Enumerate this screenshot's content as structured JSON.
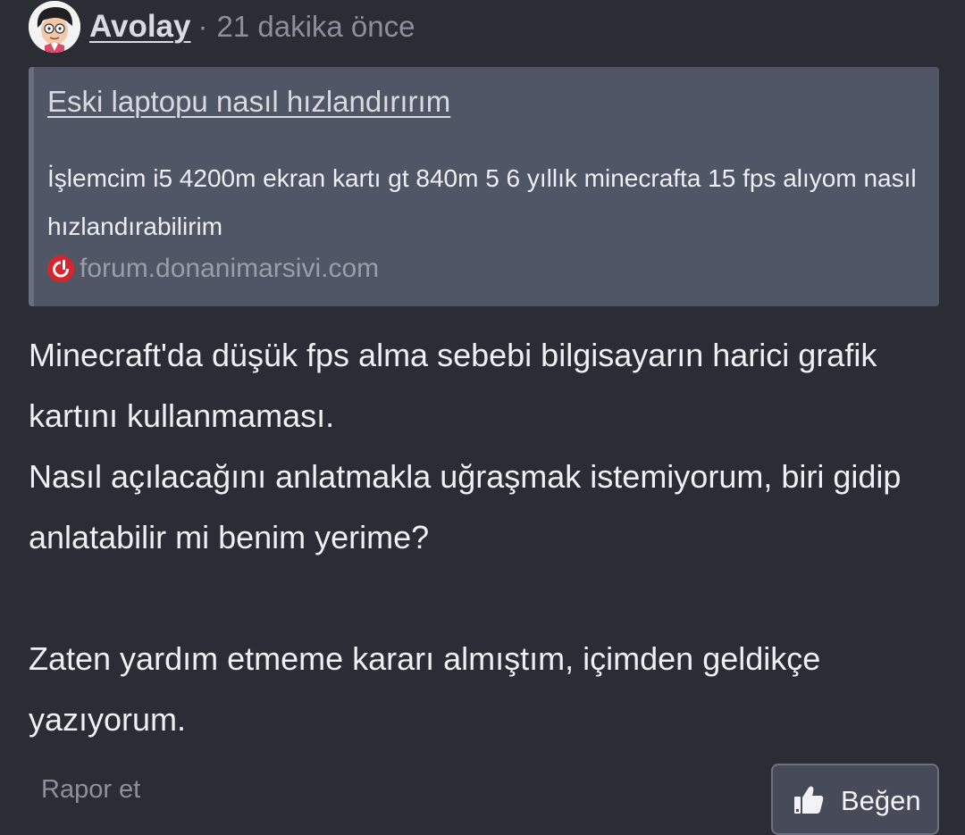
{
  "post": {
    "author": "Avolay",
    "separator": "·",
    "time": "21 dakika önce",
    "link_preview": {
      "title": "Eski laptopu nasıl hızlandırırım",
      "description": "İşlemcim i5 4200m ekran kartı gt 840m 5 6 yıllık minecrafta 15 fps alıyom nasıl hızlandırabilirim",
      "source": "forum.donanimarsivi.com",
      "favicon": "donanimarsivi-logo-icon"
    },
    "body": {
      "paragraph_1": "Minecraft'da düşük fps alma sebebi bilgisayarın harici grafik kartını kullanmaması.",
      "paragraph_2": "Nasıl açılacağını anlatmakla uğraşmak istemiyorum, biri gidip anlatabilir mi benim yerime?",
      "paragraph_3": "Zaten yardım etmeme kararı almıştım, içimden geldikçe yazıyorum."
    },
    "footer": {
      "report_label": "Rapor et",
      "like_label": "Beğen",
      "like_icon": "thumbs-up-icon"
    }
  },
  "colors": {
    "background": "#2b2d35",
    "preview_background": "#515667",
    "favicon_red": "#d6262d",
    "muted_text": "#8b8f9a"
  }
}
